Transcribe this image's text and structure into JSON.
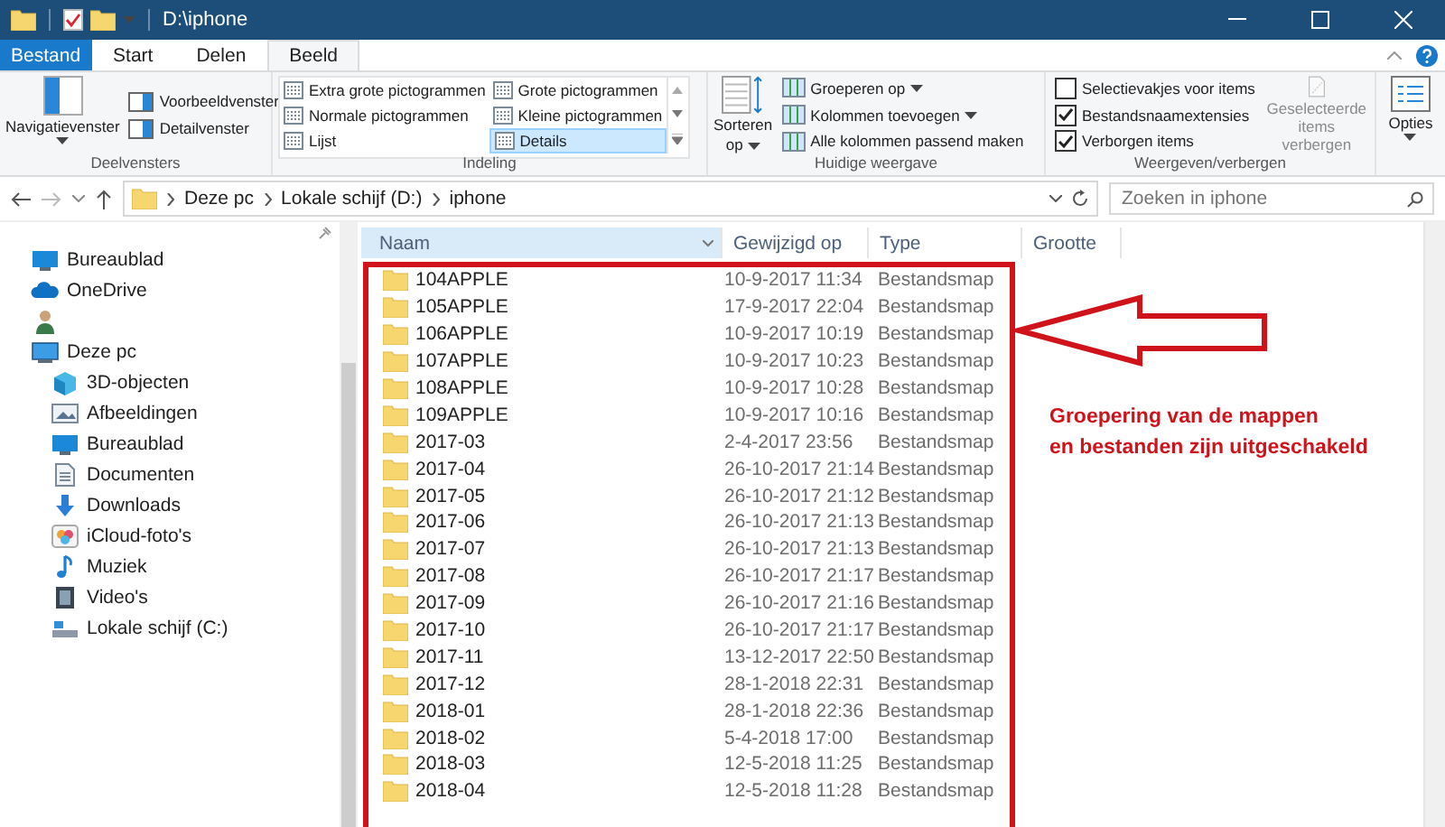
{
  "window": {
    "title": "D:\\iphone"
  },
  "ribbon_tabs": [
    {
      "label": "Bestand",
      "kind": "file",
      "selected": false
    },
    {
      "label": "Start",
      "kind": "tab",
      "selected": false
    },
    {
      "label": "Delen",
      "kind": "tab",
      "selected": false
    },
    {
      "label": "Beeld",
      "kind": "tab",
      "selected": true
    }
  ],
  "ribbon": {
    "panes": {
      "navigation": "Navigatievenster",
      "items": [
        "Voorbeeldvenster",
        "Detailvenster"
      ],
      "label": "Deelvensters"
    },
    "layout": {
      "options": [
        {
          "label": "Extra grote pictogrammen",
          "selected": false
        },
        {
          "label": "Grote pictogrammen",
          "selected": false
        },
        {
          "label": "Normale pictogrammen",
          "selected": false
        },
        {
          "label": "Kleine pictogrammen",
          "selected": false
        },
        {
          "label": "Lijst",
          "selected": false
        },
        {
          "label": "Details",
          "selected": true
        }
      ],
      "label": "Indeling"
    },
    "current_view": {
      "sort": [
        "Sorteren",
        "op"
      ],
      "items": [
        {
          "label": "Groeperen op",
          "dropdown": true
        },
        {
          "label": "Kolommen toevoegen",
          "dropdown": true
        },
        {
          "label": "Alle kolommen passend maken",
          "dropdown": false
        }
      ],
      "label": "Huidige weergave"
    },
    "show_hide": {
      "checkboxes": [
        {
          "label": "Selectievakjes voor items",
          "checked": false
        },
        {
          "label": "Bestandsnaamextensies",
          "checked": true
        },
        {
          "label": "Verborgen items",
          "checked": true
        }
      ],
      "hide_selected": "Geselecteerde items verbergen",
      "label": "Weergeven/verbergen"
    },
    "options": "Opties"
  },
  "address": {
    "breadcrumbs": [
      "Deze pc",
      "Lokale schijf (D:)",
      "iphone"
    ],
    "search_placeholder": "Zoeken in iphone"
  },
  "sidebar": {
    "items": [
      {
        "label": "Bureaublad",
        "kind": "desktop"
      },
      {
        "label": "OneDrive",
        "kind": "cloud"
      },
      {
        "kind": "user"
      },
      {
        "label": "Deze pc",
        "kind": "pc",
        "children": [
          {
            "label": "3D-objecten",
            "kind": "cube"
          },
          {
            "label": "Afbeeldingen",
            "kind": "pictures"
          },
          {
            "label": "Bureaublad",
            "kind": "desktop"
          },
          {
            "label": "Documenten",
            "kind": "documents"
          },
          {
            "label": "Downloads",
            "kind": "downloads"
          },
          {
            "label": "iCloud-foto's",
            "kind": "photos"
          },
          {
            "label": "Muziek",
            "kind": "music"
          },
          {
            "label": "Video's",
            "kind": "video"
          },
          {
            "label": "Lokale schijf (C:)",
            "kind": "drive"
          }
        ]
      }
    ]
  },
  "table": {
    "columns": [
      "Naam",
      "Gewijzigd op",
      "Type",
      "Grootte"
    ],
    "rows": [
      {
        "name": "104APPLE",
        "modified": "10-9-2017 11:34",
        "type": "Bestandsmap"
      },
      {
        "name": "105APPLE",
        "modified": "17-9-2017 22:04",
        "type": "Bestandsmap"
      },
      {
        "name": "106APPLE",
        "modified": "10-9-2017 10:19",
        "type": "Bestandsmap"
      },
      {
        "name": "107APPLE",
        "modified": "10-9-2017 10:23",
        "type": "Bestandsmap"
      },
      {
        "name": "108APPLE",
        "modified": "10-9-2017 10:28",
        "type": "Bestandsmap"
      },
      {
        "name": "109APPLE",
        "modified": "10-9-2017 10:16",
        "type": "Bestandsmap"
      },
      {
        "name": "2017-03",
        "modified": "2-4-2017 23:56",
        "type": "Bestandsmap"
      },
      {
        "name": "2017-04",
        "modified": "26-10-2017 21:14",
        "type": "Bestandsmap"
      },
      {
        "name": "2017-05",
        "modified": "26-10-2017 21:12",
        "type": "Bestandsmap"
      },
      {
        "name": "2017-06",
        "modified": "26-10-2017 21:13",
        "type": "Bestandsmap"
      },
      {
        "name": "2017-07",
        "modified": "26-10-2017 21:13",
        "type": "Bestandsmap"
      },
      {
        "name": "2017-08",
        "modified": "26-10-2017 21:17",
        "type": "Bestandsmap"
      },
      {
        "name": "2017-09",
        "modified": "26-10-2017 21:16",
        "type": "Bestandsmap"
      },
      {
        "name": "2017-10",
        "modified": "26-10-2017 21:17",
        "type": "Bestandsmap"
      },
      {
        "name": "2017-11",
        "modified": "13-12-2017 22:50",
        "type": "Bestandsmap"
      },
      {
        "name": "2017-12",
        "modified": "28-1-2018 22:31",
        "type": "Bestandsmap"
      },
      {
        "name": "2018-01",
        "modified": "28-1-2018 22:36",
        "type": "Bestandsmap"
      },
      {
        "name": "2018-02",
        "modified": "5-4-2018 17:00",
        "type": "Bestandsmap"
      },
      {
        "name": "2018-03",
        "modified": "12-5-2018 11:25",
        "type": "Bestandsmap"
      },
      {
        "name": "2018-04",
        "modified": "12-5-2018 11:28",
        "type": "Bestandsmap"
      }
    ]
  },
  "annotation": {
    "text": "Groepering van de mappen\nen bestanden zijn uitgeschakeld"
  }
}
